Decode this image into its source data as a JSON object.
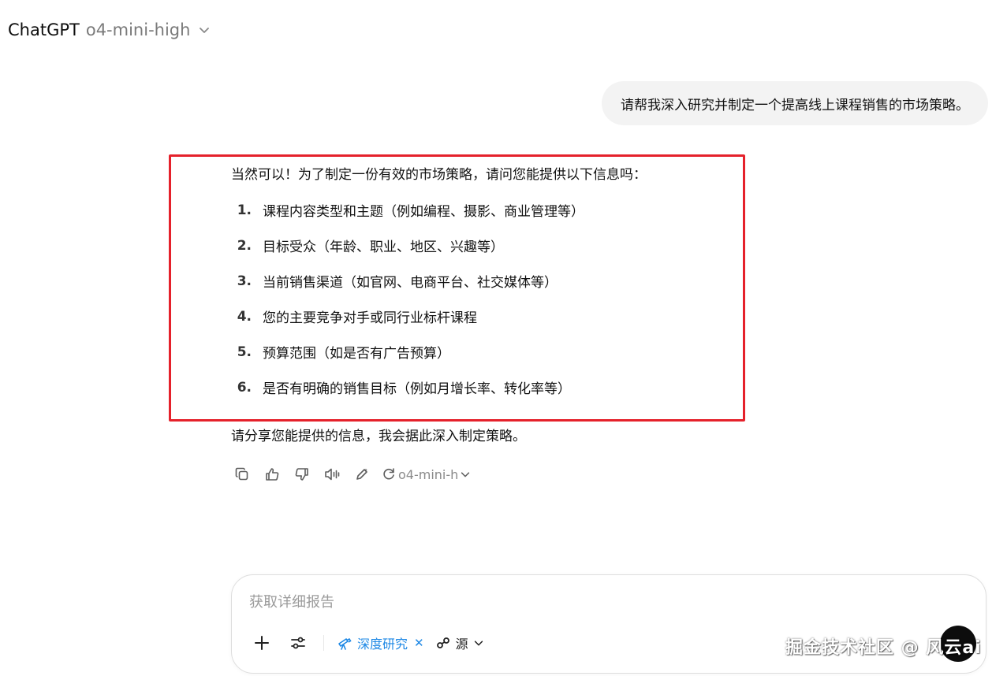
{
  "header": {
    "app_name": "ChatGPT",
    "model": "o4-mini-high"
  },
  "conversation": {
    "user_message": "请帮我深入研究并制定一个提高线上课程销售的市场策略。",
    "assistant": {
      "intro": "当然可以！为了制定一份有效的市场策略，请问您能提供以下信息吗：",
      "items": [
        {
          "num": "1.",
          "text": "课程内容类型和主题（例如编程、摄影、商业管理等）"
        },
        {
          "num": "2.",
          "text": "目标受众（年龄、职业、地区、兴趣等）"
        },
        {
          "num": "3.",
          "text": "当前销售渠道（如官网、电商平台、社交媒体等）"
        },
        {
          "num": "4.",
          "text": "您的主要竞争对手或同行业标杆课程"
        },
        {
          "num": "5.",
          "text": "预算范围（如是否有广告预算）"
        },
        {
          "num": "6.",
          "text": "是否有明确的销售目标（例如月增长率、转化率等）"
        }
      ],
      "outro": "请分享您能提供的信息，我会据此深入制定策略。"
    }
  },
  "actions": {
    "icons": [
      "copy-icon",
      "thumbs-up-icon",
      "thumbs-down-icon",
      "read-aloud-icon",
      "edit-icon",
      "regenerate-icon"
    ],
    "regen_model": "o4-mini-h"
  },
  "composer": {
    "placeholder": "获取详细报告",
    "deep_research_label": "深度研究",
    "sources_label": "源"
  },
  "watermark": "掘金技术社区 @ 风云ai",
  "colors": {
    "highlight": "#e5212b",
    "accent": "#1e88e5"
  }
}
